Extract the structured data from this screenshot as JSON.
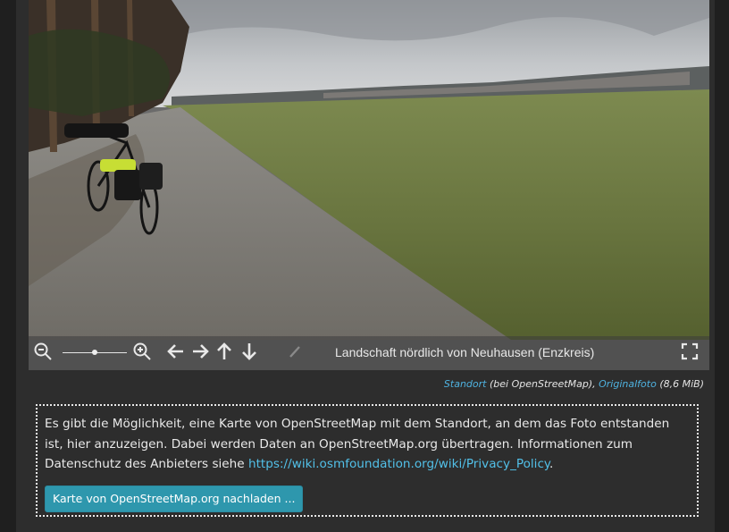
{
  "photo": {
    "caption": "Landschaft nördlich von Neuhausen (Enzkreis)"
  },
  "toolbar": {
    "zoom_level": 0.5
  },
  "credit": {
    "location_link": "Standort",
    "location_note": " (bei OpenStreetMap), ",
    "original_link": "Originalfoto",
    "size_note": " (8,6 MiB)"
  },
  "map_notice": {
    "text_before": "Es gibt die Möglichkeit, eine Karte von OpenStreetMap mit dem Standort, an dem das Foto entstanden ist, hier anzuzeigen. Dabei werden Daten an OpenStreetMap.org übertragen. Informationen zum Datenschutz des Anbieters siehe ",
    "privacy_link": "https://wiki.osmfoundation.org/wiki/Privacy_Policy",
    "text_after": ".",
    "load_button": "Karte von OpenStreetMap.org nachladen ..."
  },
  "colors": {
    "page_bg": "#1f1f1f",
    "panel_bg": "#2d2d2d",
    "link": "#4fb2e0",
    "button_bg": "#2e97ad"
  }
}
